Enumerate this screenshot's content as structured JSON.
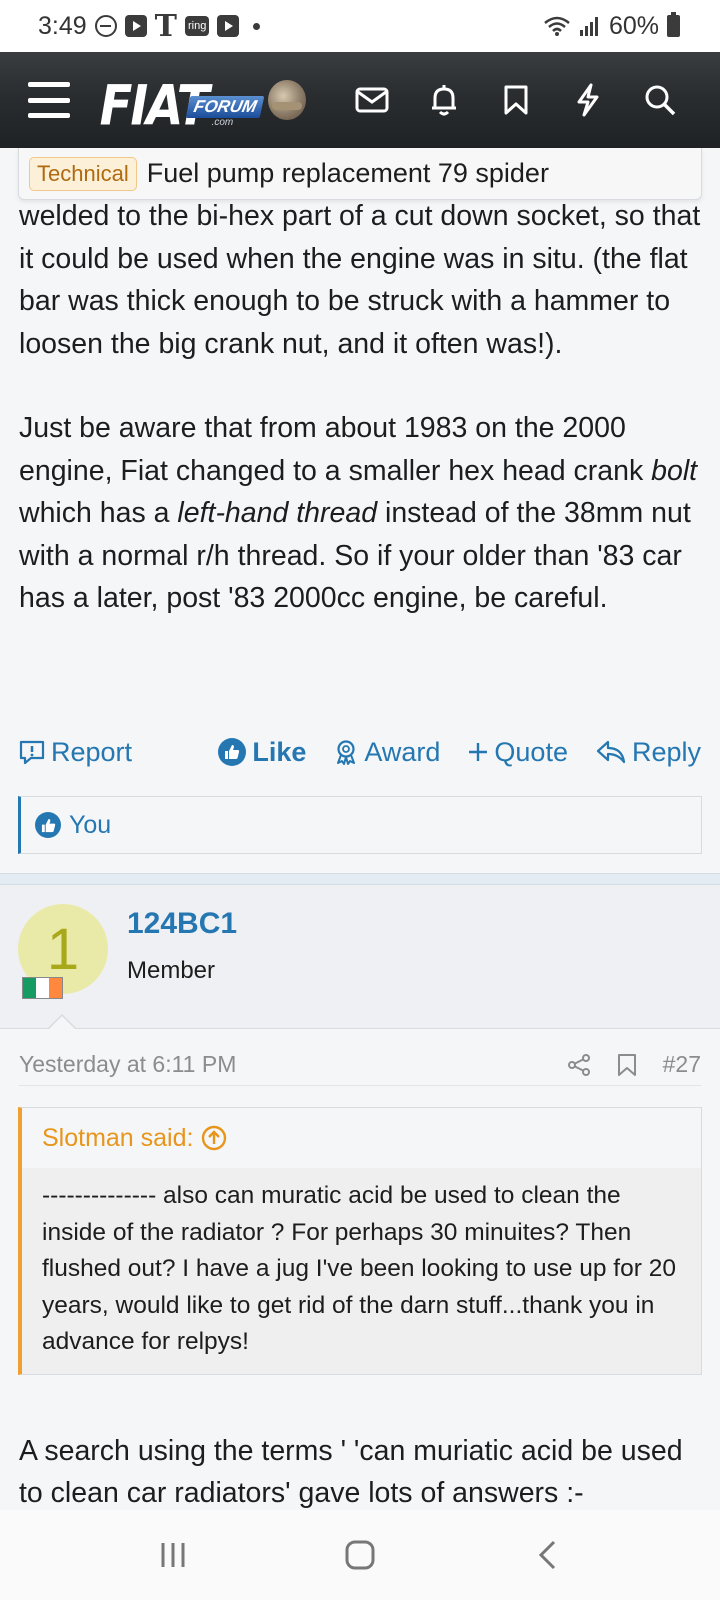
{
  "status_bar": {
    "time": "3:49",
    "ring_label": "ring",
    "battery": "60%"
  },
  "header": {
    "logo_text": "FIAT",
    "logo_forum": "FORUM",
    "logo_com": ".com",
    "icons": [
      "menu-icon",
      "mail-icon",
      "bell-icon",
      "bookmark-icon",
      "lightning-icon",
      "search-icon"
    ]
  },
  "thread": {
    "prefix": "Technical",
    "title": "Fuel pump replacement 79 spider"
  },
  "post": {
    "p1": "welded to the bi-hex part of a cut down socket, so that it could be used when the engine was in situ. (the flat bar was thick enough to be struck with a hammer to loosen the big crank nut, and it often was!).",
    "p2_a": "Just be aware that from about 1983 on the 2000 engine, Fiat changed to a smaller hex head crank ",
    "p2_em1": "bolt",
    "p2_b": " which has a ",
    "p2_em2": "left-hand thread",
    "p2_c": " instead of the 38mm nut with a normal r/h thread. So if your older than '83 car has a later, post '83 2000cc engine, be careful.",
    "actions": {
      "report": "Report",
      "like": "Like",
      "award": "Award",
      "quote": "Quote",
      "reply": "Reply"
    },
    "likes_by": "You"
  },
  "next_post": {
    "avatar_letter": "1",
    "username": "124BC1",
    "user_title": "Member",
    "timestamp": "Yesterday at 6:11 PM",
    "post_number": "#27",
    "quote": {
      "author": "Slotman said:",
      "text": "-------------- also can muratic acid be used to clean the inside of the radiator ? For perhaps 30 minuites? Then flushed out? I have a jug I've been looking to use up for 20 years, would like to get rid of the darn stuff...thank you in advance for relpys!"
    },
    "reply_text": "A search using the terms ' 'can muriatic acid be used to clean car radiators' gave lots of answers :-"
  },
  "colors": {
    "link": "#2577b1",
    "quote_accent": "#f0a030",
    "header_dark": "#2a2d30"
  }
}
